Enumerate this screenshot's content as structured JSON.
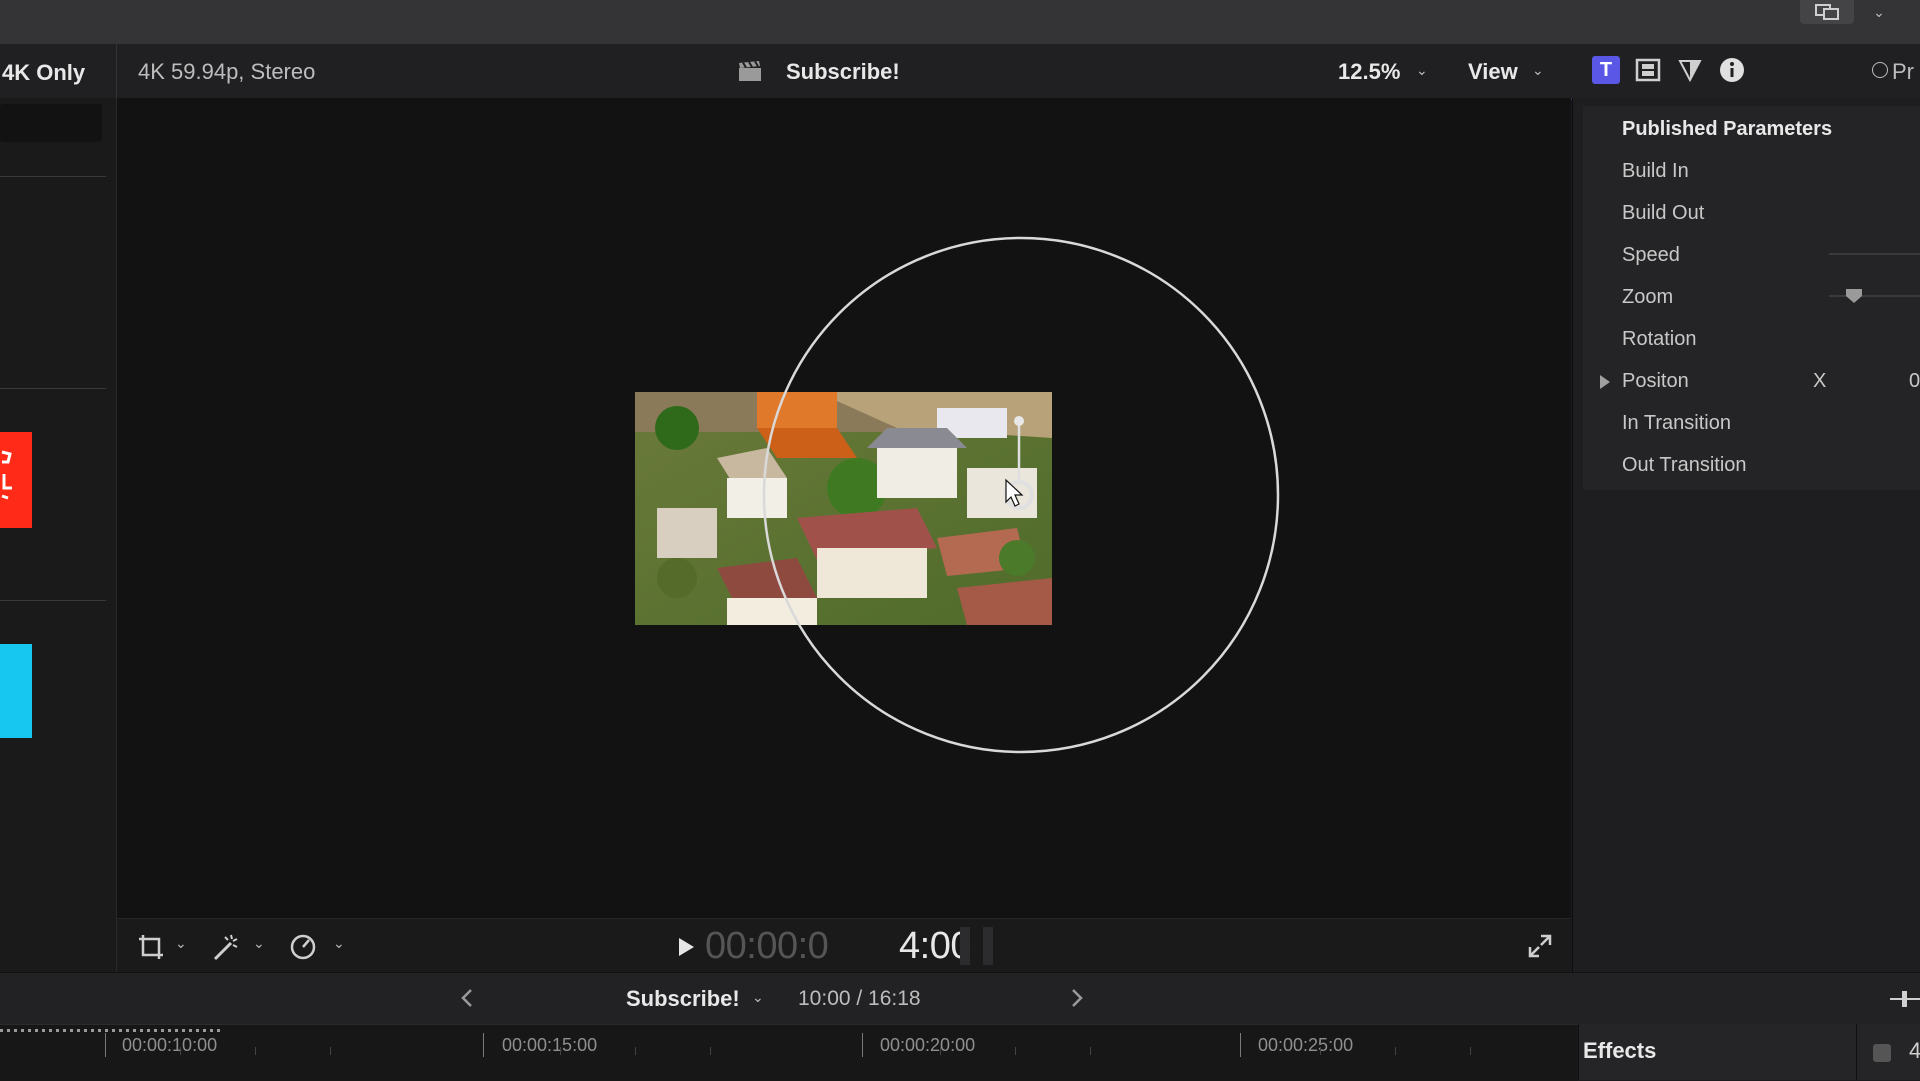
{
  "viewer_header": {
    "left_label": "4K Only",
    "format": "4K 59.94p, Stereo",
    "clip_title": "Subscribe!",
    "zoom": "12.5%",
    "view_menu": "View"
  },
  "inspector": {
    "tab_partial_label": "Pr",
    "section_title": "Published Parameters",
    "params": [
      "Build In",
      "Build Out",
      "Speed",
      "Zoom",
      "Rotation",
      "Positon",
      "In Transition",
      "Out Transition"
    ],
    "position_axis": "X",
    "position_value": "0"
  },
  "viewer_controls": {
    "timecode_dim": "00:00:0",
    "timecode_bright": "4:00"
  },
  "timeline_bar": {
    "project_name": "Subscribe!",
    "duration": "10:00 / 16:18"
  },
  "ruler": {
    "timecodes": [
      "00:00:10:00",
      "00:00:15:00",
      "00:00:20:00",
      "00:00:25:00"
    ]
  },
  "effects": {
    "title": "Effects",
    "partial": "4"
  },
  "colors": {
    "accent": "#5a56e6",
    "red_thumb": "#ff2a17",
    "cyan_thumb": "#17c7ef"
  },
  "icons": [
    "display-icon",
    "chevron-down-icon",
    "clapper-icon",
    "text-icon",
    "film-icon",
    "filter-icon",
    "info-icon",
    "crop-icon",
    "magic-wand-icon",
    "speed-icon",
    "play-icon",
    "fullscreen-icon",
    "chevron-left-icon",
    "chevron-right-icon"
  ]
}
